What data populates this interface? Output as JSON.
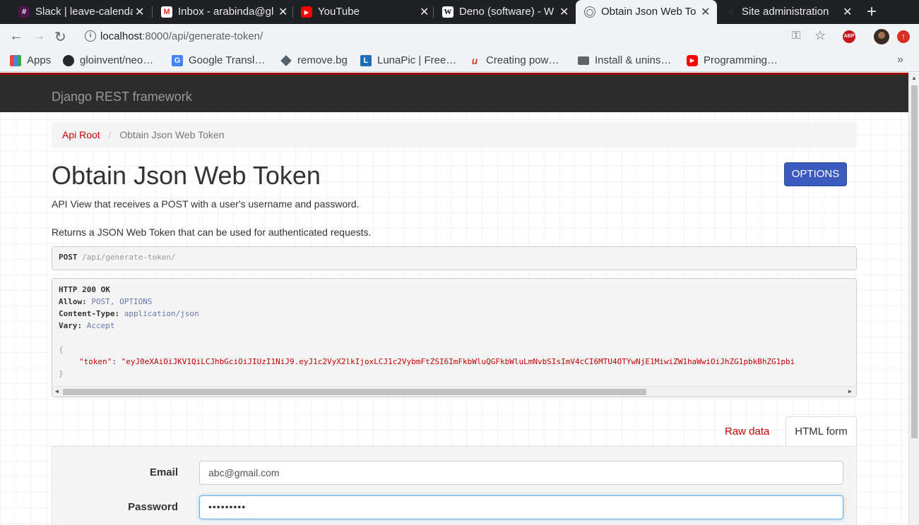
{
  "browser": {
    "tabs": [
      {
        "title": "Slack | leave-calenda",
        "icon": "slack-icon",
        "color": "#4a154b"
      },
      {
        "title": "Inbox - arabinda@gl",
        "icon": "gmail-icon",
        "color": "#d93025"
      },
      {
        "title": "YouTube",
        "icon": "youtube-icon",
        "color": "#ff0000"
      },
      {
        "title": "Deno (software) - W",
        "icon": "wikipedia-icon",
        "color": "#ffffff"
      },
      {
        "title": "Obtain Json Web To",
        "icon": "globe-icon",
        "color": "#5f6368"
      },
      {
        "title": "Site administration",
        "icon": "django-icon",
        "color": "#5f6368"
      }
    ],
    "url_host": "localhost",
    "url_path": ":8000/api/generate-token/",
    "abp_label": "ABP",
    "bookmarks": [
      {
        "label": "Apps",
        "icon": "apps-grid-icon",
        "color": "#e8453c"
      },
      {
        "label": "gloinvent/neo…",
        "icon": "github-icon",
        "color": "#24292e"
      },
      {
        "label": "Google Transl…",
        "icon": "google-translate-icon",
        "color": "#4285f4"
      },
      {
        "label": "remove.bg",
        "icon": "removebg-icon",
        "color": "#54616c"
      },
      {
        "label": "LunaPic | Free…",
        "icon": "lunapic-icon",
        "color": "#1e6fb8"
      },
      {
        "label": "Creating pow…",
        "icon": "medium-icon",
        "color": "#e03e2d"
      },
      {
        "label": "Install & unins…",
        "icon": "folder-icon",
        "color": "#5f6368"
      },
      {
        "label": "Programming…",
        "icon": "youtube-icon",
        "color": "#ff0000"
      }
    ]
  },
  "page": {
    "brand": "Django REST framework",
    "breadcrumb": {
      "root": "Api Root",
      "current": "Obtain Json Web Token"
    },
    "title": "Obtain Json Web Token",
    "options_label": "OPTIONS",
    "desc1": "API View that receives a POST with a user's username and password.",
    "desc2": "Returns a JSON Web Token that can be used for authenticated requests.",
    "request": {
      "method": "POST",
      "path": " /api/generate-token/"
    },
    "response": {
      "status": "HTTP 200 OK",
      "allow_key": "Allow:",
      "allow_val": " POST, OPTIONS",
      "ctype_key": "Content-Type:",
      "ctype_val": " application/json",
      "vary_key": "Vary:",
      "vary_val": " Accept",
      "open_brace": "{",
      "close_brace": "}",
      "token_key": "\"token\"",
      "token_sep": ": ",
      "token_val": "\"eyJ0eXAiOiJKV1QiLCJhbGciOiJIUzI1NiJ9.eyJ1c2VyX2lkIjoxLCJ1c2VybmFtZSI6ImFkbWluQGFkbWluLmNvbSIsImV4cCI6MTU4OTYwNjE1MiwiZW1haWwiOiJhZG1pbkBhZG1pbi"
    },
    "tabs": {
      "raw": "Raw data",
      "html": "HTML form"
    },
    "form": {
      "email_label": "Email",
      "email_value": "abc@gmail.com",
      "password_label": "Password",
      "password_value": "•••••••••"
    }
  }
}
